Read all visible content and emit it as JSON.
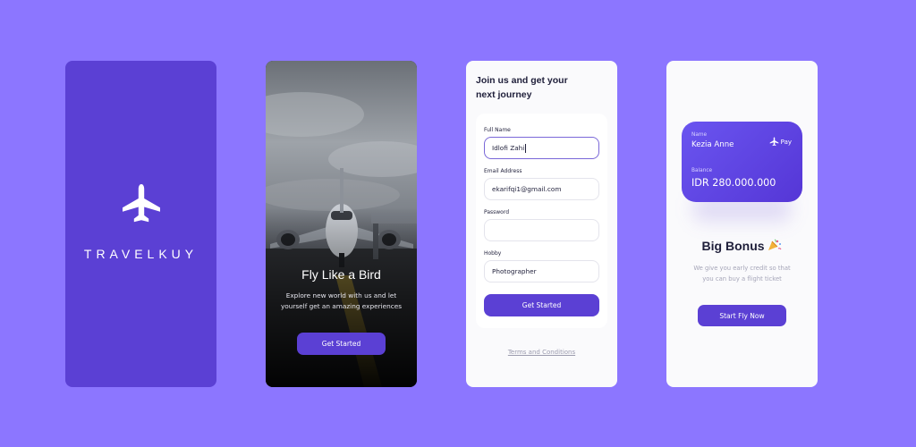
{
  "splash": {
    "brand": "TRAVELKUY",
    "icon": "airplane-icon"
  },
  "onboarding": {
    "title": "Fly Like a Bird",
    "subtitle": "Explore new world with us and let yourself get an amazing experiences",
    "button_label": "Get Started"
  },
  "signup": {
    "heading": "Join us and get your next journey",
    "fields": [
      {
        "label": "Full Name",
        "value": "Idlofi Zahi"
      },
      {
        "label": "Email Address",
        "value": "ekarifqi1@gmail.com"
      },
      {
        "label": "Password",
        "value": ""
      },
      {
        "label": "Hobby",
        "value": "Photographer"
      }
    ],
    "button_label": "Get Started",
    "terms_link": "Terms and Conditions"
  },
  "bonus": {
    "card": {
      "name_label": "Name",
      "name_value": "Kezia Anne",
      "pay_label": "Pay",
      "balance_label": "Balance",
      "balance_value": "IDR 280.000.000"
    },
    "title": "Big Bonus",
    "description": "We give you early credit so that you can buy a flight ticket",
    "button_label": "Start Fly Now"
  },
  "colors": {
    "background": "#8c76ff",
    "primary": "#5b40d4",
    "text_dark": "#1f1f3a",
    "muted": "#a5a5b8"
  }
}
